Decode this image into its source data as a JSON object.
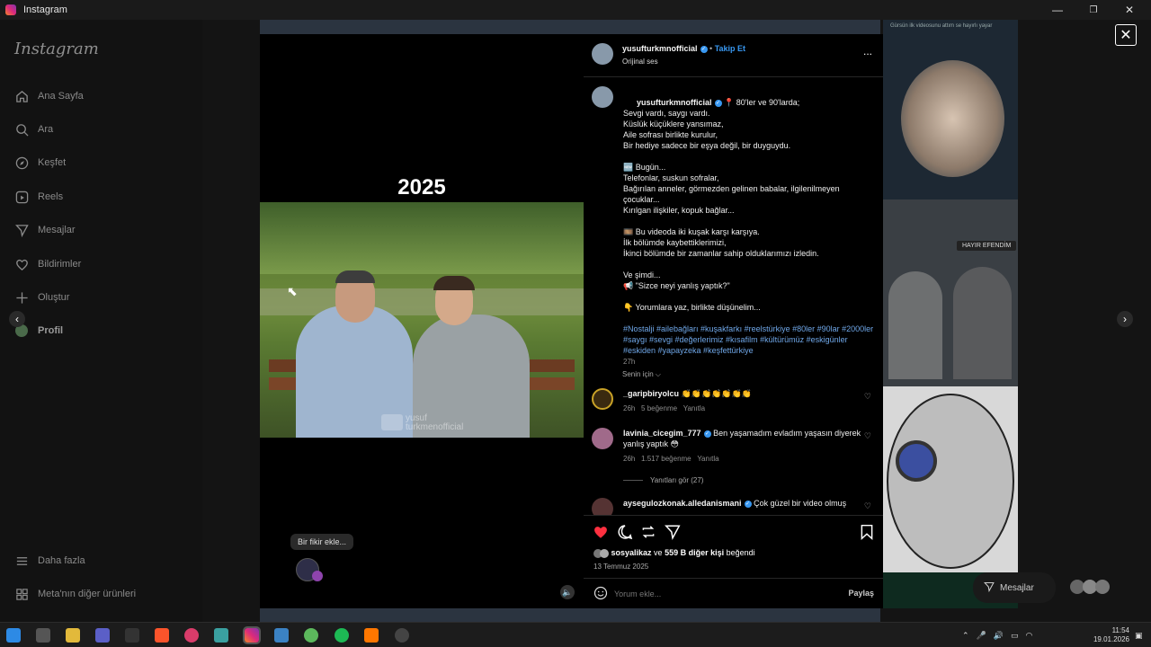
{
  "window": {
    "title": "Instagram",
    "minimize": "—",
    "restore": "❐",
    "close": "✕"
  },
  "sidebar": {
    "logo": "Instagram",
    "items": [
      {
        "label": "Ana Sayfa",
        "icon": "home-icon"
      },
      {
        "label": "Ara",
        "icon": "search-icon"
      },
      {
        "label": "Keşfet",
        "icon": "compass-icon"
      },
      {
        "label": "Reels",
        "icon": "reels-icon"
      },
      {
        "label": "Mesajlar",
        "icon": "send-icon"
      },
      {
        "label": "Bildirimler",
        "icon": "heart-icon"
      },
      {
        "label": "Oluştur",
        "icon": "plus-icon"
      },
      {
        "label": "Profil",
        "icon": "avatar-icon"
      }
    ],
    "more": "Daha fazla",
    "meta": "Meta'nın diğer ürünleri"
  },
  "video": {
    "year": "2025",
    "watermark": "yusuf\nturkmenofficial",
    "bubble": "Bir fikir ekle..."
  },
  "post": {
    "username": "yusufturkmnofficial",
    "follow": "Takip Et",
    "audio": "Orijinal ses",
    "more": "...",
    "caption_lines": [
      "📍 80'ler ve 90'larda;",
      "Sevgi vardı, saygı vardı.",
      "Küslük küçüklere yansımaz,",
      "Aile sofrası birlikte kurulur,",
      "Bir hediye sadece bir eşya değil, bir duyguydu.",
      "",
      "🆕 Bugün...",
      "Telefonlar, suskun sofralar,",
      "Bağırılan anneler, görmezden gelinen babalar, ilgilenilmeyen",
      "çocuklar...",
      "Kırılgan ilişkiler, kopuk bağlar...",
      "",
      "🎞️ Bu videoda iki kuşak karşı karşıya.",
      "İlk bölümde kaybettiklerimizi,",
      "İkinci bölümde bir zamanlar sahip olduklarımızı izledin.",
      "",
      "Ve şimdi...",
      "📢 \"Sizce neyi yanlış yaptık?\"",
      "",
      "👇 Yorumlara yaz, birlikte düşünelim..."
    ],
    "tags": "#Nostalji #ailebağları #kuşakfarkı #reelstürkiye #80ler #90lar #2000ler #saygı #sevgi #değerlerimiz #kısafilm #kültürümüz #eskigünler #eskiden #yapayzeka #keşfettürkiye",
    "time": "27h",
    "for_you": "Senin için ⌵",
    "comments": [
      {
        "user": "_garipbiryolcu",
        "verified": false,
        "text": "👏👏👏👏👏👏👏",
        "time": "26h",
        "likes": "5 beğenme",
        "reply": "Yanıtla"
      },
      {
        "user": "lavinia_cicegim_777",
        "verified": true,
        "text": "Ben yaşamadım evladım yaşasın diyerek yanlış yaptık 😳",
        "time": "26h",
        "likes": "1.517 beğenme",
        "reply": "Yanıtla"
      },
      {
        "user": "aysegulozkonak.alledanismani",
        "verified": true,
        "text": "Çok güzel bir video olmuş",
        "time": "",
        "likes": "",
        "reply": ""
      }
    ],
    "view_replies": "Yanıtları gör (27)",
    "liked_by_user": "sosyalikaz",
    "liked_by_and": " ve ",
    "liked_by_others": "559 B diğer kişi",
    "liked_by_suffix": " beğendi",
    "date": "13 Temmuz 2025",
    "comment_placeholder": "Yorum ekle...",
    "share": "Paylaş"
  },
  "right_grid": {
    "caption_top": "Gürsün ilk videosunu attım se hayırlı yayar",
    "caption_mid": "HAYIR EFENDİM",
    "messages": "Mesajlar"
  },
  "taskbar": {
    "time": "11:54",
    "date": "19.01.2026"
  },
  "colors": {
    "accent": "#3897f0",
    "like": "#ff3040"
  }
}
